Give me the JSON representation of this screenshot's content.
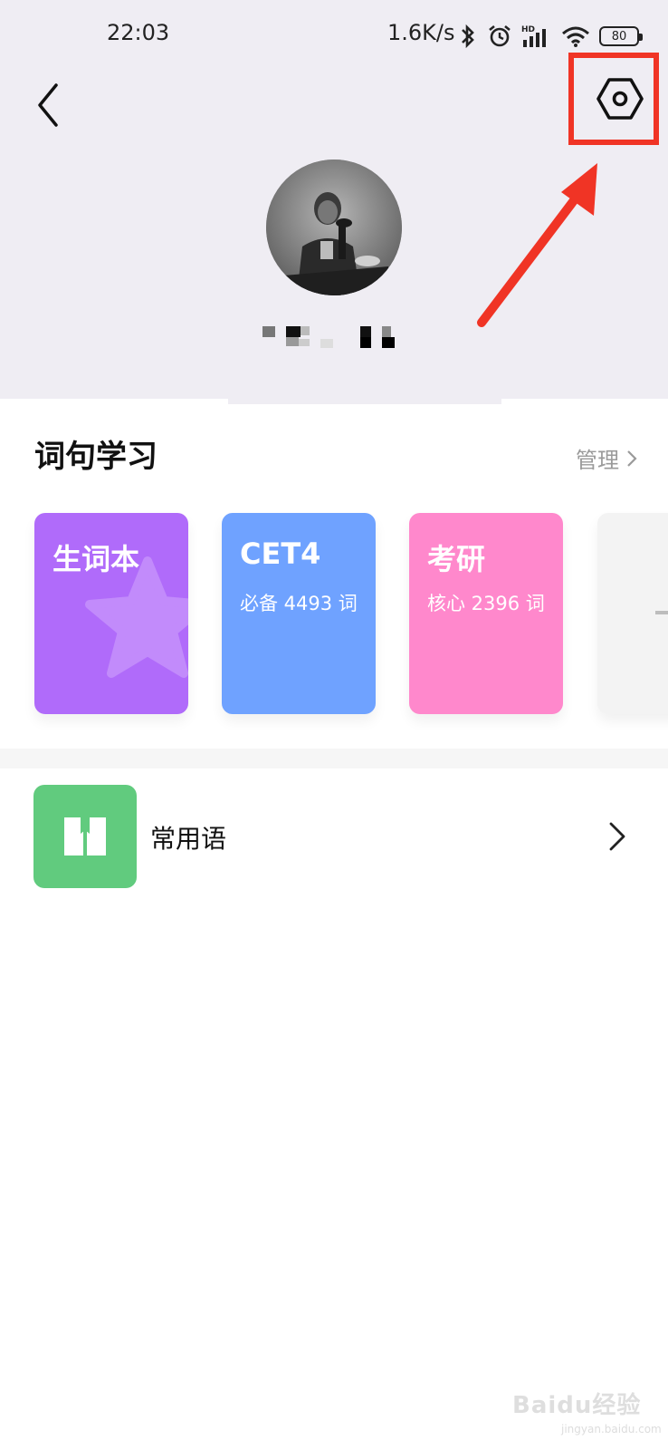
{
  "status_bar": {
    "time": "22:03",
    "net_speed": "1.6K/s",
    "battery": "80",
    "icons": [
      "bluetooth-icon",
      "alarm-icon",
      "signal-hd-icon",
      "wifi-icon",
      "battery-icon"
    ]
  },
  "header": {
    "back_icon": "chevron-left-icon",
    "settings_icon": "hexagon-settings-icon"
  },
  "section": {
    "title": "词句学习",
    "manage_label": "管理"
  },
  "cards": [
    {
      "title": "生词本",
      "subtitle": "",
      "color": "#b06bfa"
    },
    {
      "title": "CET4",
      "subtitle": "必备 4493 词",
      "color": "#6fa2ff"
    },
    {
      "title": "考研",
      "subtitle": "核心 2396 词",
      "color": "#ff88cc"
    },
    {
      "title": "",
      "subtitle": "",
      "color": "#f3f3f3"
    }
  ],
  "phrases": {
    "label": "常用语",
    "icon_color": "#61cb7e"
  },
  "watermark": {
    "text": "Baidu经验",
    "url": "jingyan.baidu.com"
  },
  "annotation_color": "#f03425"
}
